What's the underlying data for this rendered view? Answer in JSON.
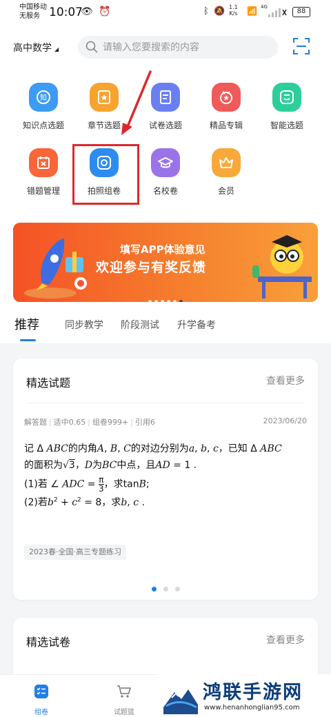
{
  "status_bar": {
    "carrier_line1": "中国移动",
    "carrier_line2": "无服务",
    "time": "10:07",
    "net_speed_value": "1.1",
    "net_speed_unit": "K/s",
    "network": "4G",
    "battery": "88"
  },
  "header": {
    "subject": "高中数学",
    "search_placeholder": "请输入您要搜索的内容"
  },
  "grid": [
    {
      "label": "知识点选题",
      "icon": "knowledge-icon",
      "color": "#3d9bf3"
    },
    {
      "label": "章节选题",
      "icon": "chapter-icon",
      "color": "#f7a42f"
    },
    {
      "label": "试卷选题",
      "icon": "paper-icon",
      "color": "#6a7ff2"
    },
    {
      "label": "精品专辑",
      "icon": "album-icon",
      "color": "#f15a5a"
    },
    {
      "label": "智能选题",
      "icon": "smart-icon",
      "color": "#2ccf9a"
    },
    {
      "label": "错题管理",
      "icon": "wrong-question-icon",
      "color": "#f9663a"
    },
    {
      "label": "拍照组卷",
      "icon": "camera-icon",
      "color": "#2d8cf0"
    },
    {
      "label": "名校卷",
      "icon": "graduation-cap-icon",
      "color": "#9a73e8"
    },
    {
      "label": "会员",
      "icon": "crown-icon",
      "color": "#f8a93a"
    }
  ],
  "banner": {
    "line1": "填写APP体验意见",
    "line2": "欢迎参与有奖反馈",
    "dot_count": 6,
    "active_dot": 5
  },
  "tabs": [
    "推荐",
    "同步教学",
    "阶段测试",
    "升学备考"
  ],
  "card1": {
    "title": "精选试题",
    "more": "查看更多",
    "meta": [
      "解答题",
      "适中0.65",
      "组卷999+",
      "引用6"
    ],
    "date": "2023/06/20",
    "tag": "2023春·全国·高三专题练习",
    "active_page": 0,
    "page_count": 3
  },
  "card2": {
    "title": "精选试卷",
    "more": "查看更多"
  },
  "bottom_nav": [
    {
      "label": "组卷",
      "active": true
    },
    {
      "label": "试题篮",
      "active": false
    }
  ],
  "watermark": {
    "text": "鸿联手游网",
    "url": "www.henanhonglian95.com"
  },
  "colors": {
    "accent": "#1e7fe6",
    "highlight": "#e0262b"
  }
}
